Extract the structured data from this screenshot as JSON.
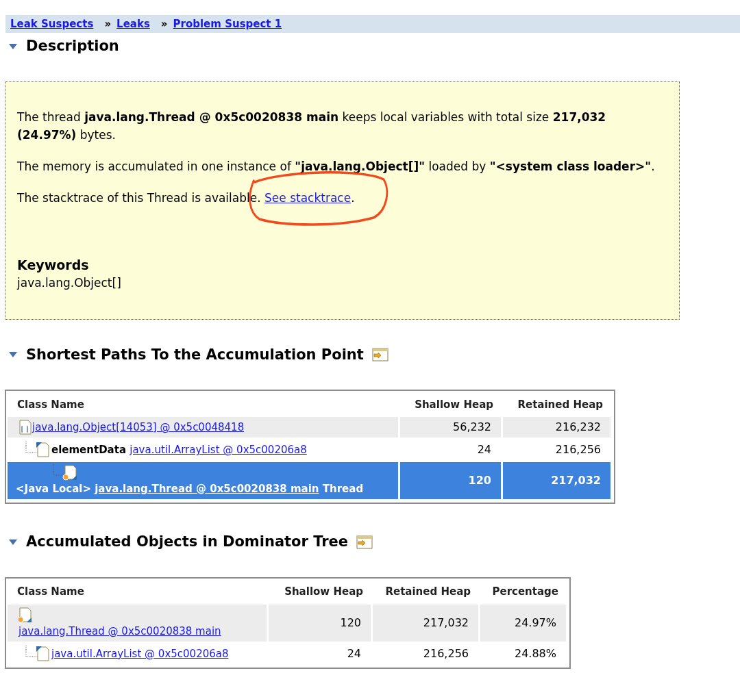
{
  "breadcrumb": [
    {
      "label": "Leak Suspects"
    },
    {
      "label": "Leaks",
      "separator": "»"
    },
    {
      "label": "Problem Suspect 1",
      "separator": "»"
    }
  ],
  "description": {
    "title": "Description",
    "expanded": true,
    "paragraphs": [
      "The thread **java.lang.Thread @ 0x5c0020838 main** keeps local variables with total size **217,032 (24.97%)** bytes.",
      "The memory is accumulated in one instance of **\"java.lang.Object[]\"** loaded by **\"<system class loader>\"**."
    ],
    "stacktrace": {
      "text": "The stacktrace of this Thread is available.",
      "link": "See stacktrace",
      "suffix": "."
    },
    "keywords_title": "Keywords",
    "keywords": "java.lang.Object[]"
  },
  "paths": {
    "title": "Shortest Paths To the Accumulation Point",
    "expanded": true,
    "columns": [
      "Class Name",
      "Shallow Heap",
      "Retained Heap"
    ],
    "rows": [
      {
        "kind": "array",
        "link": "java.lang.Object[14053] @ 0x5c0048418",
        "shallow": "56,232",
        "retained": "216,232",
        "selected": false,
        "children": [
          {
            "kind": "object",
            "prefix": "elementData",
            "link": "java.util.ArrayList @ 0x5c00206a8",
            "shallow": "24",
            "retained": "216,256",
            "selected": false,
            "children": [
              {
                "kind": "thread",
                "prefix": "<Java Local>",
                "link": "java.lang.Thread @ 0x5c0020838 main",
                "suffix": "Thread",
                "shallow": "120",
                "retained": "217,032",
                "selected": true
              }
            ]
          }
        ]
      }
    ]
  },
  "dominator": {
    "title": "Accumulated Objects in Dominator Tree",
    "expanded": true,
    "columns": [
      "Class Name",
      "Shallow Heap",
      "Retained Heap",
      "Percentage"
    ],
    "rows": [
      {
        "kind": "thread",
        "link": "java.lang.Thread @ 0x5c0020838 main",
        "shallow": "120",
        "retained": "217,032",
        "percentage": "24.97%",
        "selected": false,
        "children": [
          {
            "kind": "object",
            "link": "java.util.ArrayList @ 0x5c00206a8",
            "shallow": "24",
            "retained": "216,256",
            "percentage": "24.88%",
            "selected": false
          }
        ]
      }
    ]
  }
}
